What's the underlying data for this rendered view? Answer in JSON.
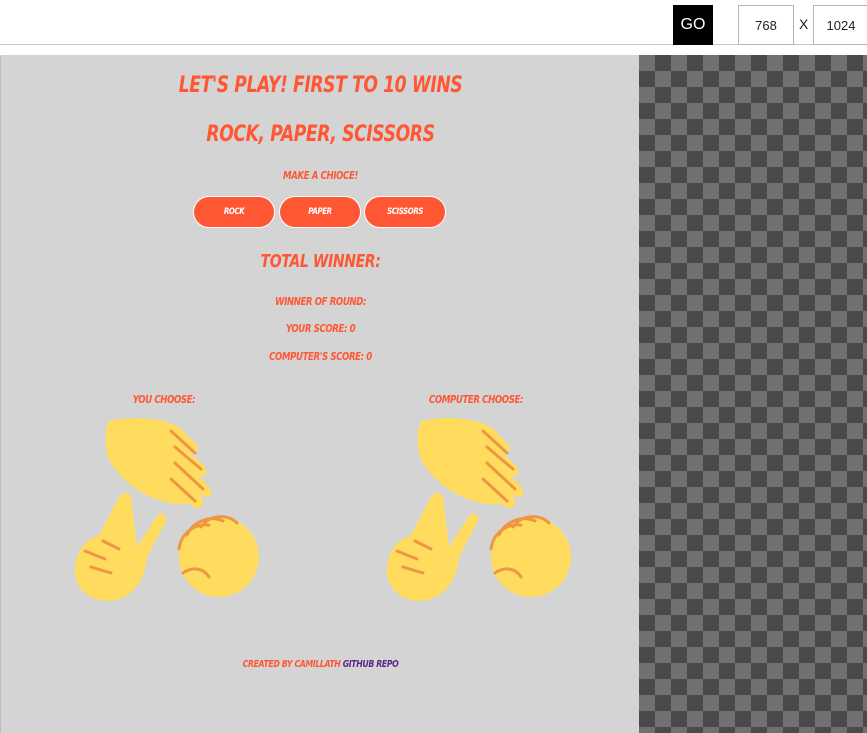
{
  "toolbar": {
    "go_label": "GO",
    "width_value": "768",
    "separator": "X",
    "height_value": "1024"
  },
  "game": {
    "title_line1": "Let's play! First to 10 wins",
    "title_line2": "Rock, Paper, Scissors",
    "prompt": "Make a chioce!",
    "buttons": [
      "Rock",
      "Paper",
      "Scissors"
    ],
    "total_winner": "Total winner:",
    "winner_of_round": "Winner of round:",
    "your_score": "Your score: 0",
    "computer_score": "Computer's score: 0",
    "you_choose": "You choose:",
    "computer_choose": "Computer choose:"
  },
  "footer": {
    "created_by": "Created by camillath",
    "repo_link": "Github repo"
  },
  "colors": {
    "accent": "#ff5733",
    "background": "#d4d4d4",
    "hand": "#ffdc5d",
    "hand_line": "#ef9645",
    "link": "#5b2a86"
  }
}
